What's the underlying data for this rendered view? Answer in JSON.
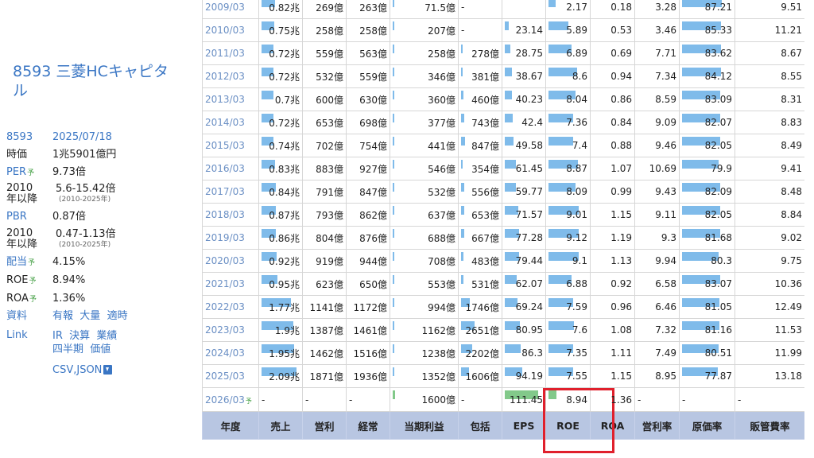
{
  "sidebar": {
    "company_title": "8593 三菱HCキャピタル",
    "code": "8593",
    "date": "2025/07/18",
    "market_cap_label": "時価",
    "market_cap": "1兆5901億円",
    "per_label": "PER",
    "yo": "予",
    "per": "9.73倍",
    "since_label": "2010年以降",
    "per_range": "5.6-15.42倍",
    "range_years": "(2010-2025年)",
    "pbr_label": "PBR",
    "pbr": "0.87倍",
    "pbr_range": "0.47-1.13倍",
    "div_label": "配当",
    "div": "4.15%",
    "roe_label": "ROE",
    "roe": "8.94%",
    "roa_label": "ROA",
    "roa": "1.36%",
    "docs_label": "資料",
    "docs_links": [
      "有報",
      "大量",
      "適時"
    ],
    "link_label": "Link",
    "link_links": [
      "IR",
      "決算",
      "業績",
      "四半期",
      "価値"
    ],
    "csv_json": "CSV,JSON"
  },
  "table": {
    "headers": [
      "年度",
      "売上",
      "営利",
      "経常",
      "当期利益",
      "包括",
      "EPS",
      "ROE",
      "ROA",
      "営利率",
      "原価率",
      "販管費率"
    ],
    "rows": [
      {
        "year": "2009/03",
        "uri": "0.82兆",
        "eiri": "269億",
        "keijo": "263億",
        "touki": "71.5億",
        "houkatsu": "-",
        "eps": "",
        "roe": "2.17",
        "roa": "0.18",
        "eirir": "3.28",
        "genka": "87.21",
        "hankan": "9.51",
        "b": [
          0.39,
          0,
          0,
          0.03,
          0,
          0,
          0.2,
          0,
          0,
          0.87
        ]
      },
      {
        "year": "2010/03",
        "uri": "0.75兆",
        "eiri": "258億",
        "keijo": "258億",
        "touki": "207億",
        "houkatsu": "-",
        "eps": "23.14",
        "roe": "5.89",
        "roa": "0.53",
        "eirir": "3.46",
        "genka": "85.33",
        "hankan": "11.21",
        "b": [
          0.36,
          0,
          0,
          0.03,
          0,
          0.12,
          0.55,
          0,
          0,
          0.85
        ]
      },
      {
        "year": "2011/03",
        "uri": "0.72兆",
        "eiri": "559億",
        "keijo": "563億",
        "touki": "258億",
        "houkatsu": "278億",
        "eps": "28.75",
        "roe": "6.89",
        "roa": "0.69",
        "eirir": "7.71",
        "genka": "83.62",
        "hankan": "8.67",
        "b": [
          0.34,
          0,
          0,
          0.03,
          0.04,
          0.15,
          0.65,
          0,
          0,
          0.84
        ]
      },
      {
        "year": "2012/03",
        "uri": "0.72兆",
        "eiri": "532億",
        "keijo": "559億",
        "touki": "346億",
        "houkatsu": "381億",
        "eps": "38.67",
        "roe": "8.6",
        "roa": "0.94",
        "eirir": "7.34",
        "genka": "84.12",
        "hankan": "8.55",
        "b": [
          0.34,
          0,
          0,
          0.03,
          0.05,
          0.2,
          0.8,
          0,
          0,
          0.84
        ]
      },
      {
        "year": "2013/03",
        "uri": "0.7兆",
        "eiri": "600億",
        "keijo": "630億",
        "touki": "360億",
        "houkatsu": "460億",
        "eps": "40.23",
        "roe": "8.04",
        "roa": "0.86",
        "eirir": "8.59",
        "genka": "83.09",
        "hankan": "8.31",
        "b": [
          0.33,
          0,
          0,
          0.03,
          0.06,
          0.21,
          0.75,
          0,
          0,
          0.83
        ]
      },
      {
        "year": "2014/03",
        "uri": "0.72兆",
        "eiri": "653億",
        "keijo": "698億",
        "touki": "377億",
        "houkatsu": "743億",
        "eps": "42.4",
        "roe": "7.36",
        "roa": "0.84",
        "eirir": "9.09",
        "genka": "82.07",
        "hankan": "8.83",
        "b": [
          0.34,
          0,
          0,
          0.03,
          0.1,
          0.22,
          0.7,
          0,
          0,
          0.82
        ]
      },
      {
        "year": "2015/03",
        "uri": "0.74兆",
        "eiri": "702億",
        "keijo": "754億",
        "touki": "441億",
        "houkatsu": "847億",
        "eps": "49.58",
        "roe": "7.4",
        "roa": "0.88",
        "eirir": "9.46",
        "genka": "82.05",
        "hankan": "8.49",
        "b": [
          0.35,
          0,
          0,
          0.03,
          0.12,
          0.26,
          0.7,
          0,
          0,
          0.82
        ]
      },
      {
        "year": "2016/03",
        "uri": "0.83兆",
        "eiri": "883億",
        "keijo": "927億",
        "touki": "546億",
        "houkatsu": "354億",
        "eps": "61.45",
        "roe": "8.87",
        "roa": "1.07",
        "eirir": "10.69",
        "genka": "79.9",
        "hankan": "9.41",
        "b": [
          0.39,
          0,
          0,
          0.03,
          0.05,
          0.32,
          0.82,
          0,
          0,
          0.8
        ]
      },
      {
        "year": "2017/03",
        "uri": "0.84兆",
        "eiri": "791億",
        "keijo": "847億",
        "touki": "532億",
        "houkatsu": "556億",
        "eps": "59.77",
        "roe": "8.09",
        "roa": "0.99",
        "eirir": "9.43",
        "genka": "82.09",
        "hankan": "8.48",
        "b": [
          0.4,
          0,
          0,
          0.03,
          0.08,
          0.31,
          0.76,
          0,
          0,
          0.82
        ]
      },
      {
        "year": "2018/03",
        "uri": "0.87兆",
        "eiri": "793億",
        "keijo": "862億",
        "touki": "637億",
        "houkatsu": "653億",
        "eps": "71.57",
        "roe": "9.01",
        "roa": "1.15",
        "eirir": "9.11",
        "genka": "82.05",
        "hankan": "8.84",
        "b": [
          0.41,
          0,
          0,
          0.03,
          0.09,
          0.38,
          0.84,
          0,
          0,
          0.82
        ]
      },
      {
        "year": "2019/03",
        "uri": "0.86兆",
        "eiri": "804億",
        "keijo": "876億",
        "touki": "688億",
        "houkatsu": "667億",
        "eps": "77.28",
        "roe": "9.12",
        "roa": "1.19",
        "eirir": "9.3",
        "genka": "81.68",
        "hankan": "9.02",
        "b": [
          0.41,
          0,
          0,
          0.03,
          0.09,
          0.41,
          0.85,
          0,
          0,
          0.82
        ]
      },
      {
        "year": "2020/03",
        "uri": "0.92兆",
        "eiri": "919億",
        "keijo": "944億",
        "touki": "708億",
        "houkatsu": "483億",
        "eps": "79.44",
        "roe": "9.1",
        "roa": "1.13",
        "eirir": "9.94",
        "genka": "80.3",
        "hankan": "9.75",
        "b": [
          0.44,
          0,
          0,
          0.03,
          0.07,
          0.42,
          0.85,
          0,
          0,
          0.8
        ]
      },
      {
        "year": "2021/03",
        "uri": "0.95兆",
        "eiri": "623億",
        "keijo": "650億",
        "touki": "553億",
        "houkatsu": "531億",
        "eps": "62.07",
        "roe": "6.88",
        "roa": "0.92",
        "eirir": "6.58",
        "genka": "83.07",
        "hankan": "10.36",
        "b": [
          0.45,
          0,
          0,
          0.03,
          0.07,
          0.33,
          0.64,
          0,
          0,
          0.83
        ]
      },
      {
        "year": "2022/03",
        "uri": "1.77兆",
        "eiri": "1141億",
        "keijo": "1172億",
        "touki": "994億",
        "houkatsu": "1746億",
        "eps": "69.24",
        "roe": "7.59",
        "roa": "0.96",
        "eirir": "6.46",
        "genka": "81.05",
        "hankan": "12.49",
        "b": [
          0.85,
          0,
          0,
          0.03,
          0.25,
          0.37,
          0.7,
          0,
          0,
          0.81
        ]
      },
      {
        "year": "2023/03",
        "uri": "1.9兆",
        "eiri": "1387億",
        "keijo": "1461億",
        "touki": "1162億",
        "houkatsu": "2651億",
        "eps": "80.95",
        "roe": "7.6",
        "roa": "1.08",
        "eirir": "7.32",
        "genka": "81.16",
        "hankan": "11.53",
        "b": [
          0.91,
          0,
          0,
          0.03,
          0.38,
          0.43,
          0.71,
          0,
          0,
          0.81
        ]
      },
      {
        "year": "2024/03",
        "uri": "1.95兆",
        "eiri": "1462億",
        "keijo": "1516億",
        "touki": "1238億",
        "houkatsu": "2202億",
        "eps": "86.3",
        "roe": "7.35",
        "roa": "1.11",
        "eirir": "7.49",
        "genka": "80.51",
        "hankan": "11.99",
        "b": [
          0.94,
          0,
          0,
          0.03,
          0.31,
          0.46,
          0.69,
          0,
          0,
          0.8
        ]
      },
      {
        "year": "2025/03",
        "uri": "2.09兆",
        "eiri": "1871億",
        "keijo": "1936億",
        "touki": "1352億",
        "houkatsu": "1606億",
        "eps": "94.19",
        "roe": "7.55",
        "roa": "1.15",
        "eirir": "8.95",
        "genka": "77.87",
        "hankan": "13.18",
        "b": [
          1,
          0,
          0,
          0.03,
          0.23,
          0.5,
          0.7,
          0,
          0,
          0.78
        ]
      }
    ],
    "forecast": {
      "year": "2026/03",
      "yo": "予",
      "uri": "-",
      "eiri": "-",
      "keijo": "-",
      "touki": "1600億",
      "houkatsu": "-",
      "eps": "111.45",
      "roe": "8.94",
      "roa": "1.36",
      "eirir": "-",
      "genka": "-",
      "hankan": "-",
      "b": [
        0,
        0,
        0,
        0.04,
        0,
        0.95,
        0.22,
        0,
        0,
        0
      ]
    }
  },
  "colors": {
    "bar": "#7fbbea",
    "forecast_bar": "#82c98a",
    "header_bg": "#b8c6e2",
    "highlight": "#e0202c",
    "link": "#3a76c4"
  }
}
